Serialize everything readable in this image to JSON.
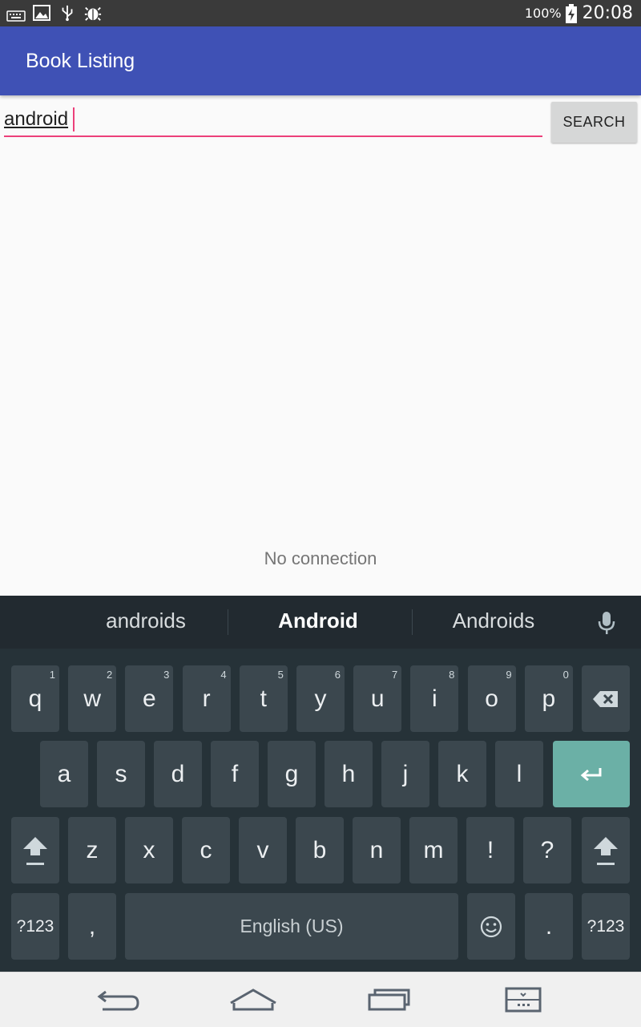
{
  "status_bar": {
    "battery": "100%",
    "time": "20:08",
    "icons": [
      "keyboard-icon",
      "image-icon",
      "usb-icon",
      "bug-icon",
      "battery-charging-icon"
    ]
  },
  "app": {
    "title": "Book Listing",
    "primary_color": "#3f51b5",
    "accent_color": "#ec407a"
  },
  "search": {
    "value": "android",
    "button_label": "SEARCH"
  },
  "empty_state": "No connection",
  "keyboard": {
    "suggestions": [
      "androids",
      "Android",
      "Androids"
    ],
    "row1": [
      {
        "label": "q",
        "hint": "1"
      },
      {
        "label": "w",
        "hint": "2"
      },
      {
        "label": "e",
        "hint": "3"
      },
      {
        "label": "r",
        "hint": "4"
      },
      {
        "label": "t",
        "hint": "5"
      },
      {
        "label": "y",
        "hint": "6"
      },
      {
        "label": "u",
        "hint": "7"
      },
      {
        "label": "i",
        "hint": "8"
      },
      {
        "label": "o",
        "hint": "9"
      },
      {
        "label": "p",
        "hint": "0"
      }
    ],
    "row2": [
      "a",
      "s",
      "d",
      "f",
      "g",
      "h",
      "j",
      "k",
      "l"
    ],
    "row3": [
      "z",
      "x",
      "c",
      "v",
      "b",
      "n",
      "m",
      "!",
      "?"
    ],
    "symbols_label": "?123",
    "comma": ",",
    "space_label": "English (US)",
    "period": "."
  },
  "nav_bar": {
    "icons": [
      "back-icon",
      "home-icon",
      "recents-icon",
      "keyboard-switch-icon"
    ]
  }
}
